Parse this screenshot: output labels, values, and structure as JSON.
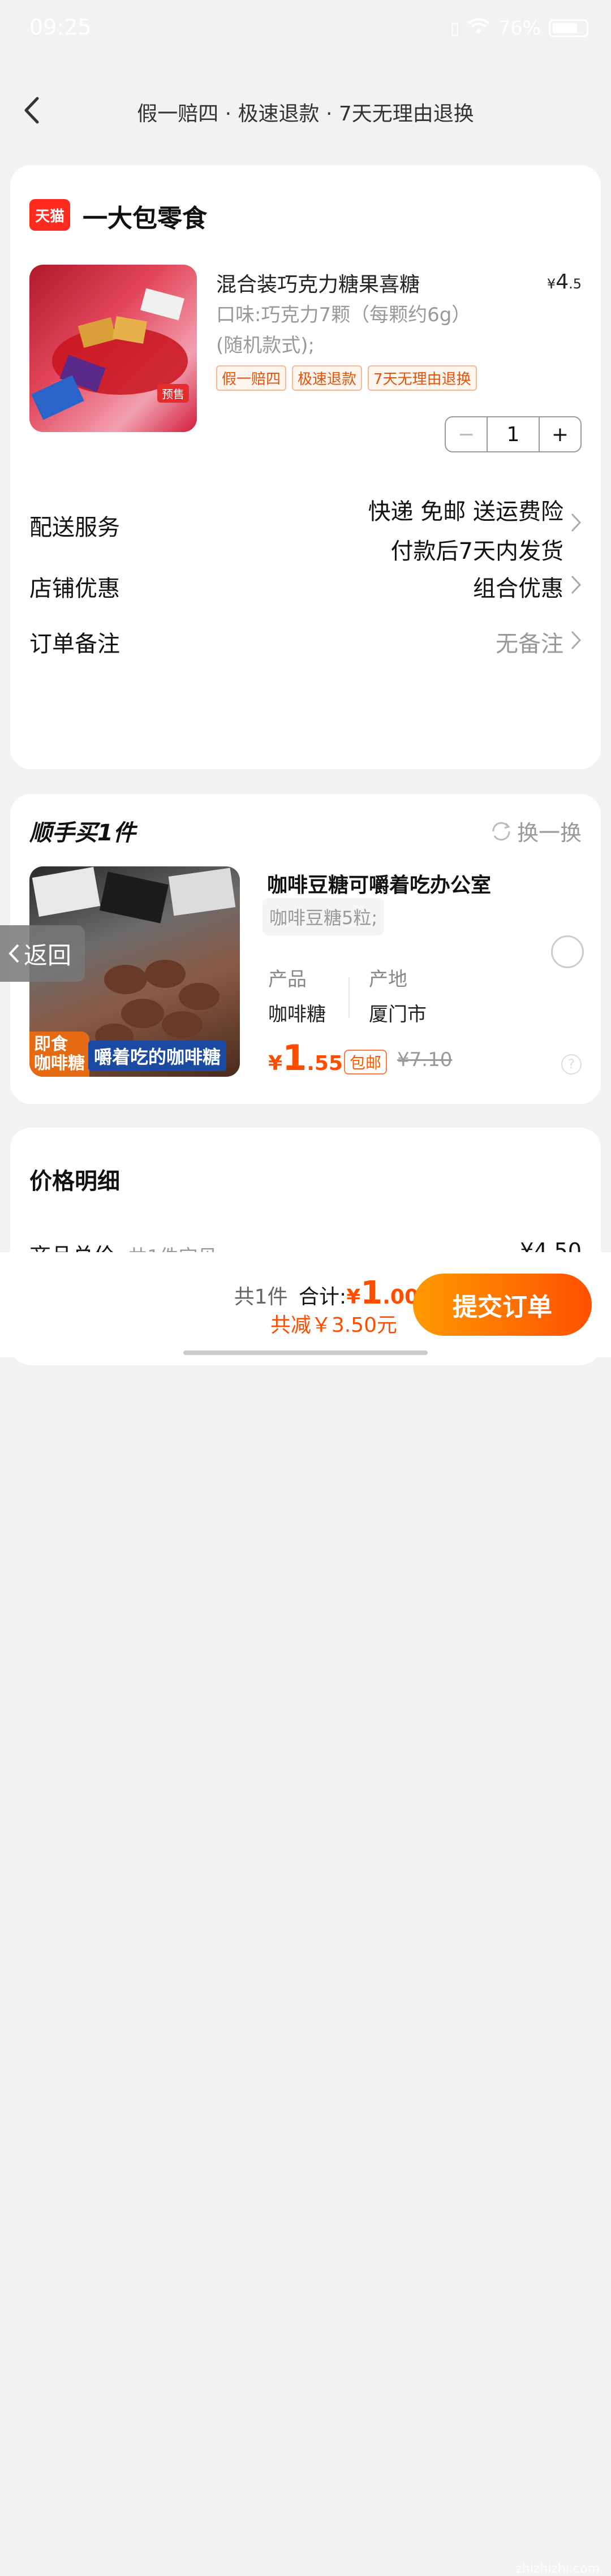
{
  "status_bar": {
    "time": "09:25",
    "battery": "76%",
    "battery_level": 0.76
  },
  "header": {
    "guarantee": "假一赔四 · 极速退款 · 7天无理由退换"
  },
  "shop": {
    "logo_text": "天猫",
    "name": "一大包零食"
  },
  "product": {
    "title": "混合装巧克力糖果喜糖",
    "price_symbol": "¥",
    "price_int": "4",
    "price_dec": ".5",
    "image_tag": "预售",
    "sku_line1": "口味:巧克力7颗（每颗约6g）",
    "sku_line2": "(随机款式);",
    "tags": [
      "假一赔四",
      "极速退款",
      "7天无理由退换"
    ],
    "quantity": "1"
  },
  "delivery": {
    "label": "配送服务",
    "line1": "快递 免邮 送运费险",
    "line2": "付款后7天内发货"
  },
  "shop_discount": {
    "label": "店铺优惠",
    "value": "组合优惠"
  },
  "order_note": {
    "label": "订单备注",
    "value": "无备注"
  },
  "addon": {
    "title": "顺手买1件",
    "swap": "换一换",
    "img_label1": "即食\n咖啡糖",
    "img_label2": "嚼着吃的咖啡糖",
    "name": "咖啡豆糖可嚼着吃办公室",
    "sku": "咖啡豆糖5粒;",
    "attr1_key": "产品",
    "attr1_val": "咖啡糖",
    "attr2_key": "产地",
    "attr2_val": "厦门市",
    "price_symbol": "¥",
    "price_int": "1",
    "price_dec": ".55",
    "free_ship": "包邮",
    "orig_price": "¥7.10",
    "help": "?"
  },
  "float_back": {
    "label": "返回"
  },
  "price_detail": {
    "title": "价格明细",
    "row_label": "商品总价",
    "row_note": "共1件宝贝",
    "row_value": "¥4.50"
  },
  "bottom": {
    "count": "共1件",
    "total_label": "合计:",
    "total_symbol": "¥",
    "total_int": "1",
    "total_dec": ".00",
    "saved": "共减￥3.50元",
    "submit": "提交订单",
    "watermark": "zhizhizhi.com"
  },
  "colors": {
    "accent": "#ff5000",
    "price": "#ff4d00",
    "tmall": "#ff2b1f"
  }
}
